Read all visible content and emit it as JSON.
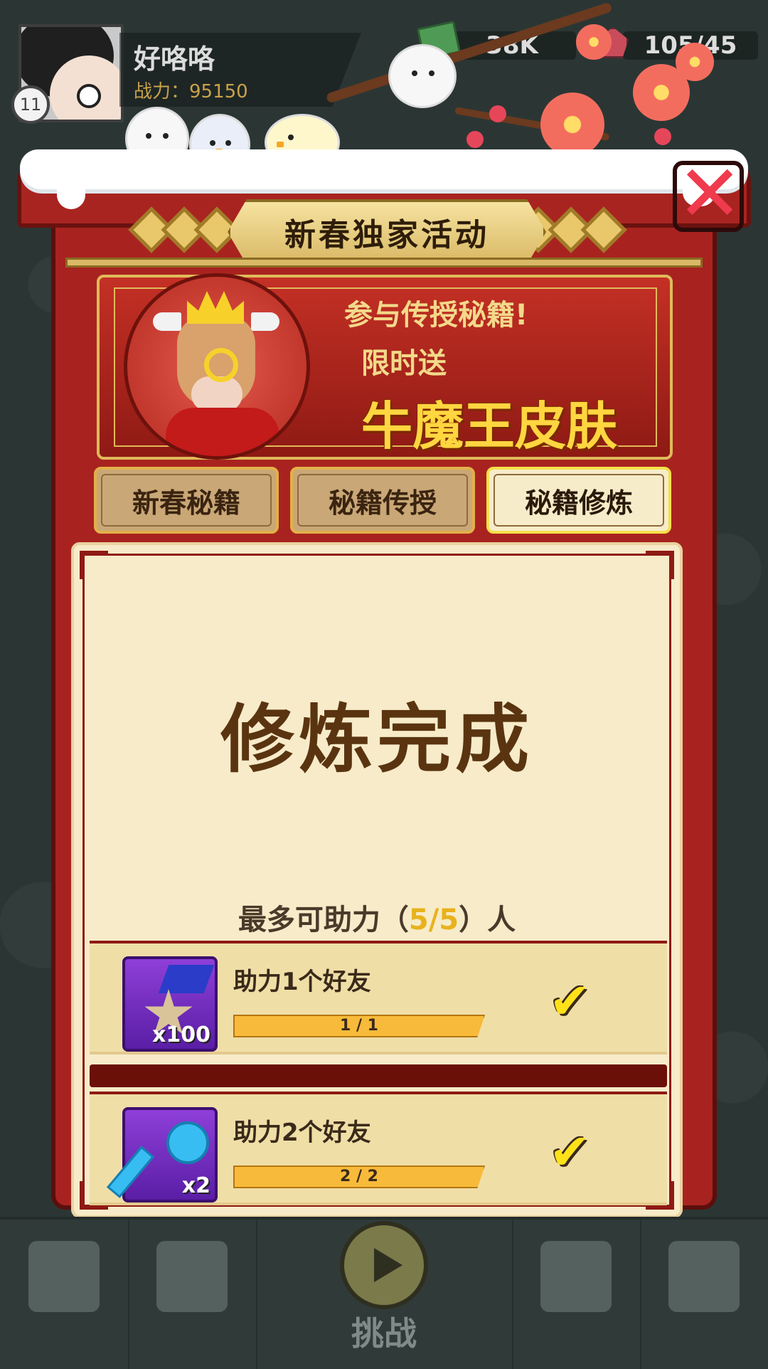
{
  "player": {
    "name": "好咯咯",
    "power_label": "战力：95150",
    "level": "11"
  },
  "resources": {
    "cash": "38K",
    "energy": "105/45"
  },
  "event": {
    "title": "新春独家活动",
    "promo_line1": "参与传授秘籍!",
    "promo_line2": "限时送",
    "promo_skin": "牛魔王皮肤"
  },
  "tabs": [
    {
      "label": "新春秘籍",
      "active": false
    },
    {
      "label": "秘籍传授",
      "active": false
    },
    {
      "label": "秘籍修炼",
      "active": true
    }
  ],
  "content": {
    "status": "修炼完成",
    "assist_prefix": "最多可助力（",
    "assist_count": "5/5",
    "assist_suffix": "）人",
    "tasks": [
      {
        "label": "助力1个好友",
        "reward_qty": "x100",
        "reward_icon": "sheriff-medal-icon",
        "progress": "1 / 1",
        "progress_fraction": 1.0,
        "completed": true
      },
      {
        "label": "助力2个好友",
        "reward_qty": "x2",
        "reward_icon": "key-icon",
        "progress": "2 / 2",
        "progress_fraction": 1.0,
        "completed": true
      }
    ]
  },
  "bottom_nav": {
    "challenge_label": "挑战",
    "items": [
      "shop-cart-icon",
      "book-icon",
      "play-icon",
      "scroll-icon",
      "lucky-cat-icon"
    ]
  },
  "colors": {
    "panel_red": "#a8231f",
    "gold": "#d9b966",
    "cream": "#f7ebc9",
    "check_yellow": "#ffe11a",
    "close_red": "#f03a4d"
  }
}
